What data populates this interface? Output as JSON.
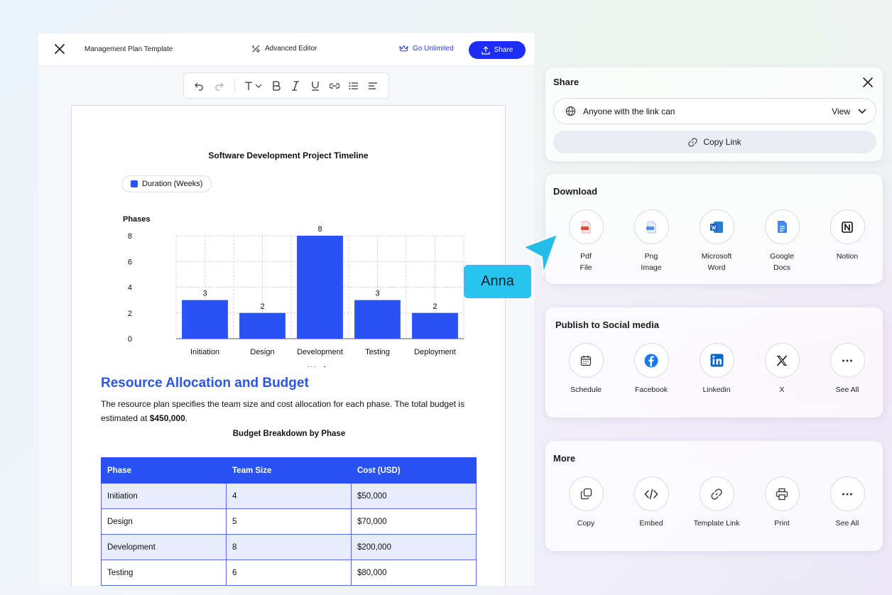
{
  "header": {
    "doc_title": "Management Plan Template",
    "advanced_editor": "Advanced Editor",
    "go_unlimited": "Go Unlimited",
    "share": "Share"
  },
  "document": {
    "chart_data": {
      "type": "bar",
      "title": "Software Development Project Timeline",
      "legend": "Duration (Weeks)",
      "ylabel": "Phases",
      "xlabel": "Weeks",
      "categories": [
        "Initiation",
        "Design",
        "Development",
        "Testing",
        "Deployment"
      ],
      "values": [
        3,
        2,
        8,
        3,
        2
      ],
      "ylim": [
        0,
        8
      ],
      "yticks": [
        0,
        2,
        4,
        6,
        8
      ],
      "color": "#2952f5",
      "grid": true
    },
    "section_title": "Resource Allocation and Budget",
    "paragraph_text": "The resource plan specifies the team size and cost allocation for each phase. The total budget is estimated at ",
    "paragraph_bold": "$450,000",
    "paragraph_end": ".",
    "table_title": "Budget Breakdown by Phase",
    "table": {
      "headers": [
        "Phase",
        "Team Size",
        "Cost (USD)"
      ],
      "rows": [
        [
          "Initiation",
          "4",
          "$50,000"
        ],
        [
          "Design",
          "5",
          "$70,000"
        ],
        [
          "Development",
          "8",
          "$200,000"
        ],
        [
          "Testing",
          "6",
          "$80,000"
        ]
      ]
    }
  },
  "share_panel": {
    "title": "Share",
    "permission_label": "Anyone with the link can",
    "permission_value": "View",
    "copy_link": "Copy Link"
  },
  "download": {
    "title": "Download",
    "items": [
      "Pdf\nFile",
      "Png\nImage",
      "Microsoft\nWord",
      "Google\nDocs",
      "Notion"
    ]
  },
  "social": {
    "title": "Publish to Social media",
    "items": [
      "Schedule",
      "Facebook",
      "Linkedin",
      "X",
      "See All"
    ]
  },
  "more": {
    "title": "More",
    "items": [
      "Copy",
      "Embed",
      "Template Link",
      "Print",
      "See All"
    ]
  },
  "collaborator": {
    "name": "Anna"
  }
}
